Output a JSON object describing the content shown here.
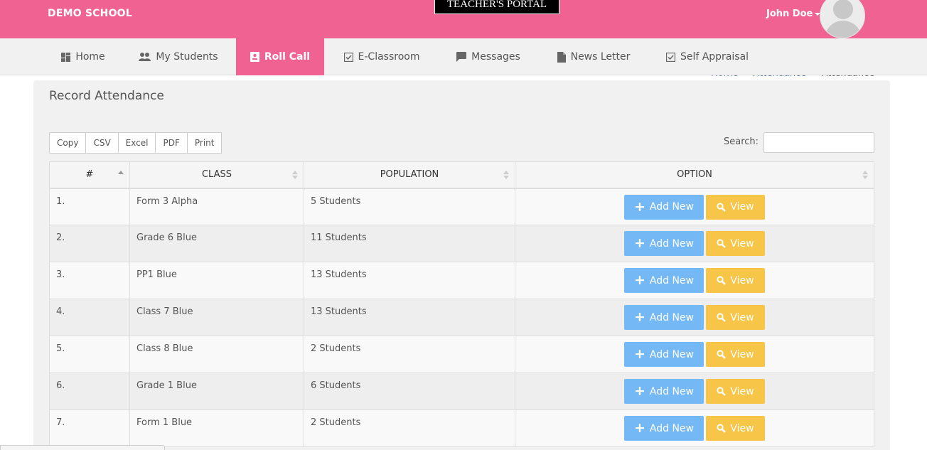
{
  "header": {
    "school": "DEMO SCHOOL",
    "portal_title": "TEACHER'S PORTAL",
    "user_name": "John Doe"
  },
  "nav": {
    "items": [
      {
        "label": "Home",
        "icon": "dashboard-icon"
      },
      {
        "label": "My Students",
        "icon": "people-icon"
      },
      {
        "label": "Roll Call",
        "icon": "badge-icon",
        "active": true
      },
      {
        "label": "E-Classroom",
        "icon": "checkbox-icon"
      },
      {
        "label": "Messages",
        "icon": "chat-icon"
      },
      {
        "label": "News Letter",
        "icon": "document-icon"
      },
      {
        "label": "Self Appraisal",
        "icon": "checkbox-icon"
      }
    ]
  },
  "breadcrumb": {
    "items": [
      "Home",
      "Attendance",
      "Attendance"
    ]
  },
  "panel": {
    "title": "Record Attendance",
    "export_buttons": [
      "Copy",
      "CSV",
      "Excel",
      "PDF",
      "Print"
    ],
    "search_label": "Search:",
    "search_value": ""
  },
  "table": {
    "headers": [
      "#",
      "CLASS",
      "POPULATION",
      "OPTION"
    ],
    "add_label": "Add New",
    "view_label": "View",
    "rows": [
      {
        "num": "1.",
        "class": "Form 3 Alpha",
        "population": "5 Students"
      },
      {
        "num": "2.",
        "class": "Grade 6 Blue",
        "population": "11 Students"
      },
      {
        "num": "3.",
        "class": "PP1 Blue",
        "population": "13 Students"
      },
      {
        "num": "4.",
        "class": "Class 7 Blue",
        "population": "13 Students"
      },
      {
        "num": "5.",
        "class": "Class 8 Blue",
        "population": "2 Students"
      },
      {
        "num": "6.",
        "class": "Grade 1 Blue",
        "population": "6 Students"
      },
      {
        "num": "7.",
        "class": "Form 1 Blue",
        "population": "2 Students"
      }
    ]
  },
  "colors": {
    "brand": "#f06292",
    "add_button": "#74b9f5",
    "view_button": "#f7c547"
  }
}
